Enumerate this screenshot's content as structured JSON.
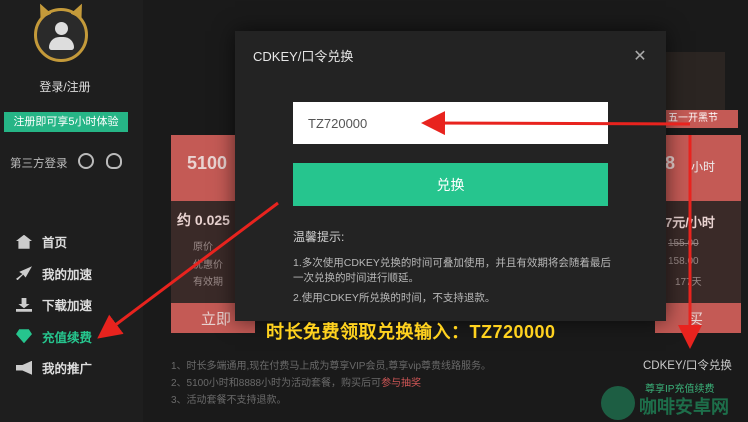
{
  "sidebar": {
    "login_label": "登录/注册",
    "trial_badge": "注册即可享5小时体验",
    "third_party_label": "第三方登录",
    "nav": [
      {
        "label": "首页",
        "icon": "home-icon"
      },
      {
        "label": "我的加速",
        "icon": "rocket-icon"
      },
      {
        "label": "下载加速",
        "icon": "download-icon"
      },
      {
        "label": "充值续费",
        "icon": "gem-icon",
        "active": true
      },
      {
        "label": "我的推广",
        "icon": "megaphone-icon"
      }
    ]
  },
  "background": {
    "left_card_hours": "5100",
    "left_price": "约 0.025",
    "left_orig_label": "原价",
    "left_act_label": "优惠价",
    "left_valid_label": "有效期",
    "left_buy": "立即",
    "right_card_hours": "8",
    "right_unit": "小时",
    "right_price": "7元/小时",
    "right_orig": "155.00",
    "right_price2": "158.00",
    "right_days": "177天",
    "right_buy": "买",
    "banner_tag": "五一开黑节",
    "notes": [
      "1、时长多端通用,现在付费马上成为尊享VIP会员,尊享vip尊贵线路服务。",
      "2、5100小时和8888小时为活动套餐，购买后可",
      "3、活动套餐不支持退款。"
    ],
    "notes_highlight": "参与抽奖",
    "cdkey_link": "CDKEY/口令兑换",
    "vip_link": "尊享IP充值续费",
    "watermark": "咖啡安卓网"
  },
  "modal": {
    "title": "CDKEY/口令兑换",
    "close_icon": "close-icon",
    "input_value": "TZ720000",
    "redeem_label": "兑换",
    "tips_title": "温馨提示:",
    "tip1": "1.多次使用CDKEY兑换的时间可叠加使用，并且有效期将会随着最后一次兑换的时间进行顺延。",
    "tip2": "2.使用CDKEY所兑换的时间，不支持退款。"
  },
  "overlay_caption": "时长免费领取兑换输入：TZ720000",
  "colors": {
    "accent": "#26c58e",
    "arrow": "#e8231e",
    "caption": "#ffd21f"
  }
}
